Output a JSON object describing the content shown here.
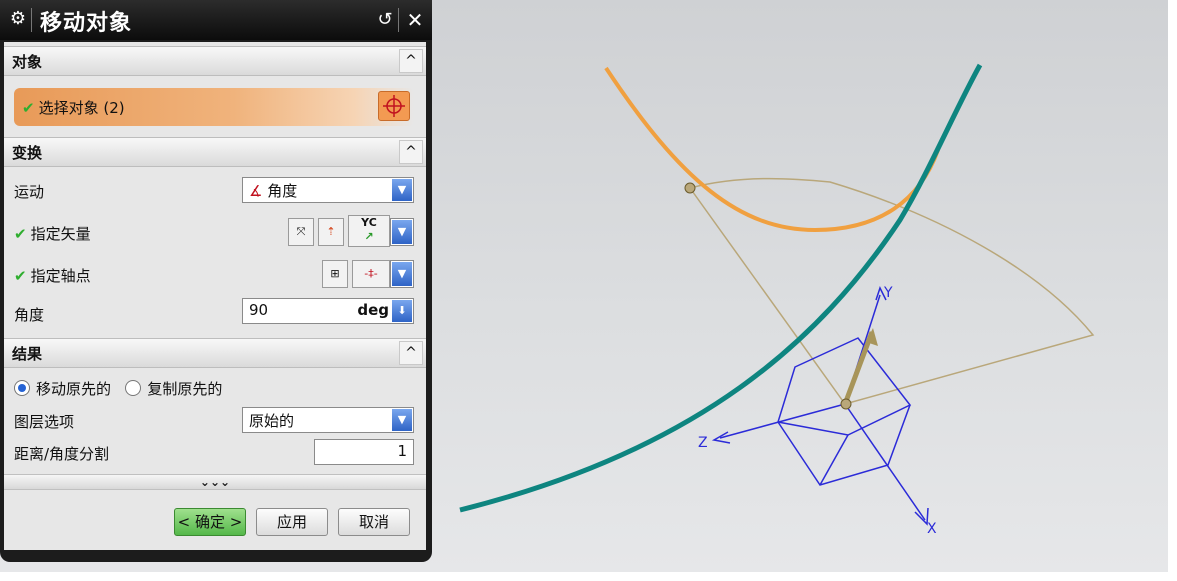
{
  "dialog": {
    "title": "移动对象",
    "sections": {
      "object": "对象",
      "transform": "变换",
      "result": "结果"
    },
    "select_object_label": "选择对象 (2)",
    "motion_label": "运动",
    "motion_value": "角度",
    "vector_label": "指定矢量",
    "vector_option": "YC",
    "pivot_label": "指定轴点",
    "angle_label": "角度",
    "angle_value": "90",
    "angle_unit": "deg",
    "move_original": "移动原先的",
    "copy_original": "复制原先的",
    "layer_label": "图层选项",
    "layer_value": "原始的",
    "divide_label": "距离/角度分割",
    "divide_value": "1",
    "more_glyph": "⌄⌄⌄",
    "ok_button": "< 确定 >",
    "apply_button": "应用",
    "cancel_button": "取消"
  },
  "viewport": {
    "axes": {
      "x": "X",
      "y": "Y",
      "z": "Z"
    },
    "colors": {
      "orange_curve": "#f0a040",
      "teal_curve": "#0e8580",
      "triad": "#2b2bd8",
      "preview_arc": "#b9a77a",
      "vector_arrow": "#a8955a"
    }
  }
}
